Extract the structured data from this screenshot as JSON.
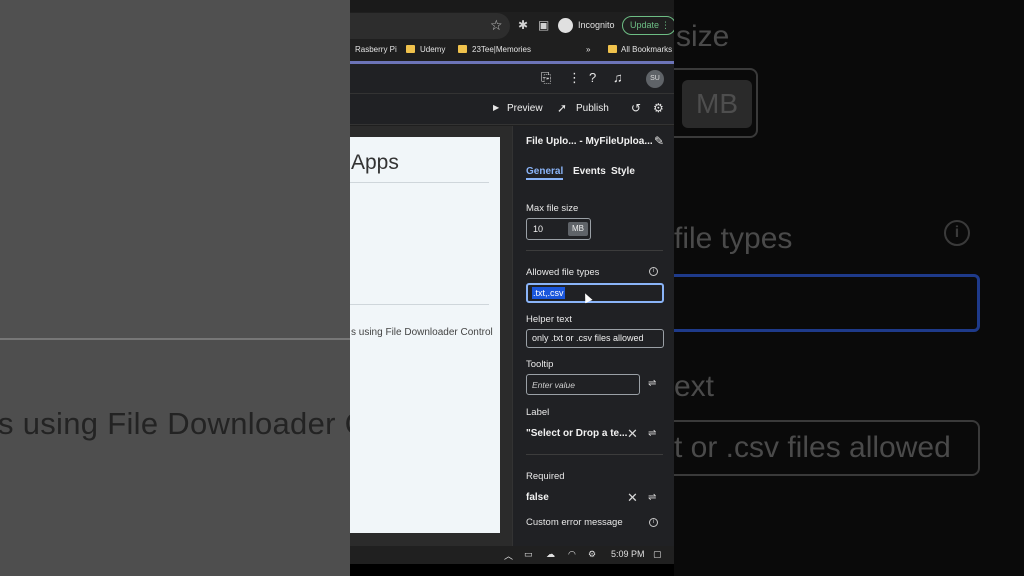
{
  "browser": {
    "incognito_label": "Incognito",
    "update_label": "Update",
    "bookmarks": [
      "Rasberry Pi",
      "Udemy",
      "23Tee|Memories",
      "All Bookmarks"
    ],
    "bookmarks_overflow": "»"
  },
  "toolbar": {
    "preview_label": "Preview",
    "publish_label": "Publish",
    "avatar_initials": "SU"
  },
  "canvas": {
    "title": "Apps",
    "description": "s using File Downloader Control"
  },
  "panel": {
    "title": "File Uplo...  - MyFileUploa...",
    "tabs": [
      {
        "label": "General",
        "active": true
      },
      {
        "label": "Events",
        "active": false
      },
      {
        "label": "Style",
        "active": false
      }
    ],
    "max_file_size": {
      "label": "Max file size",
      "value": "10",
      "unit": "MB"
    },
    "allowed_file_types": {
      "label": "Allowed file types",
      "value": ".txt,.csv"
    },
    "helper_text": {
      "label": "Helper text",
      "value": "only .txt or .csv files allowed"
    },
    "tooltip": {
      "label": "Tooltip",
      "placeholder": "Enter value"
    },
    "label_field": {
      "label": "Label",
      "value": "\"Select or Drop a te..."
    },
    "required": {
      "label": "Required",
      "value": "false"
    },
    "custom_error": {
      "label": "Custom error message"
    }
  },
  "taskbar": {
    "time": "5:09 PM"
  },
  "background": {
    "left_text": "s using File Downloader C",
    "right_size": "size",
    "right_mb": "MB",
    "right_file_types": "file types",
    "right_ext": "ext",
    "right_allowed": "t or .csv files allowed"
  },
  "colors": {
    "accent": "#8ab4f8",
    "selection": "#1a56db",
    "update": "#6dbd84"
  }
}
